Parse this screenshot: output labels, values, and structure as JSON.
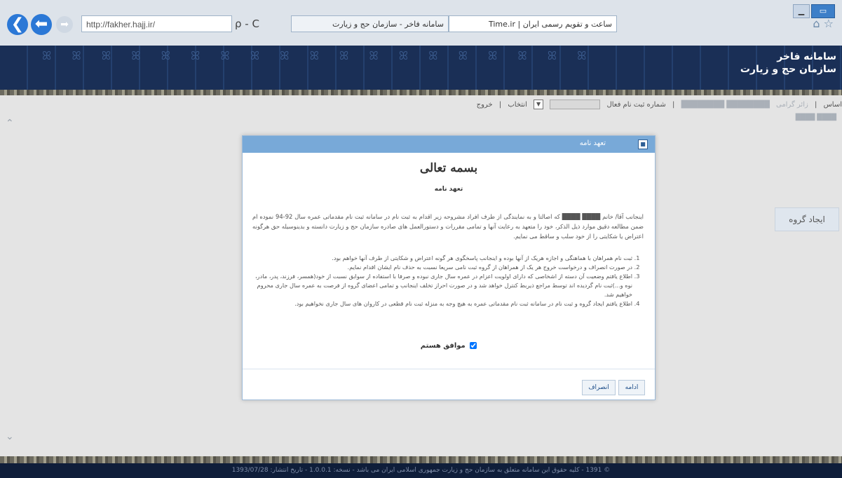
{
  "browser": {
    "address": "http://fakher.hajj.ir/",
    "address_tools": "ρ - C",
    "tabs": [
      {
        "label": "سامانه فاخر - سازمان حج و زیارت"
      },
      {
        "label": "ساعت و تقویم رسمی ایران | Time.ir"
      }
    ]
  },
  "header": {
    "title_line1": "سامانه فاخر",
    "title_line2": "سازمان حج و زیارت",
    "pattern": "ꕤ ꕤ ꕤ ꕤ ꕤ ꕤ ꕤ ꕤ ꕤ ꕤ ꕤ ꕤ ꕤ ꕤ ꕤ ꕤ ꕤ ꕤ ꕤ ꕤ"
  },
  "menu": {
    "home": "اساس",
    "dashboard": "زائر گرامی",
    "sep": "|",
    "registration": "شماره ثبت نام فعال",
    "history": "انتخاب",
    "exit": "خروج"
  },
  "sidebar": {
    "group_button": "ایجاد گروه"
  },
  "modal": {
    "header_title": "تعهد نامه",
    "close_icon": "■",
    "bismillah": "بسمه تعالی",
    "subtitle": "تعهد نامه",
    "paragraph": "اینجانب آقا/ خانم ████ ████ که اصالتا و به نمایندگی از طرف افراد مشروحه زیر اقدام به ثبت نام در سامانه ثبت نام مقدماتی عمره سال 92-94 نموده ام ضمن مطالعه دقیق موارد ذیل الذکر، خود را متعهد به رعایت آنها و تمامی مقررات و دستورالعمل های صادره سازمان حج و زیارت دانسته و بدینوسیله حق هرگونه اعتراض یا شکایتی را از خود سلب و ساقط می نمایم.",
    "items": [
      "ثبت نام همراهان با هماهنگی و اجازه هریک از آنها بوده و اینجانب پاسخگوی هر گونه اعتراض و شکایتی از طرف آنها خواهم بود.",
      "در صورت انصراف و درخواست خروج هر یک از همراهان از گروه ثبت نامی سریعا نسبت به حذف نام ایشان اقدام نمایم.",
      "اطلاع یافتم وضعیت آن دسته از اشخاصی که دارای اولویت اعزام در عمره سال جاری نبوده و صرفا با استفاده از سوابق نسبت از خود(همسر، فرزند، پدر، مادر، نوه و...)ثبت نام گردیده اند توسط مراجع ذیربط کنترل خواهد شد و در صورت احراز تخلف اینجانب و تمامی اعضای گروه از فرصت به عمره سال جاری محروم خواهیم شد.",
      "اطلاع یافتم ایجاد گروه و ثبت نام در سامانه ثبت نام مقدماتی عمره به هیچ وجه به منزله ثبت نام قطعی در کاروان های سال جاری نخواهیم بود."
    ],
    "agree_label": "موافق هستم",
    "btn_next": "ادامه",
    "btn_cancel": "انصراف"
  },
  "footer": {
    "text": "© 1391 - کلیه حقوق این سامانه متعلق به سازمان حج و زیارت جمهوری اسلامی ایران می باشد - نسخه: 1.0.0.1 - تاریخ انتشار: 1393/07/28"
  }
}
